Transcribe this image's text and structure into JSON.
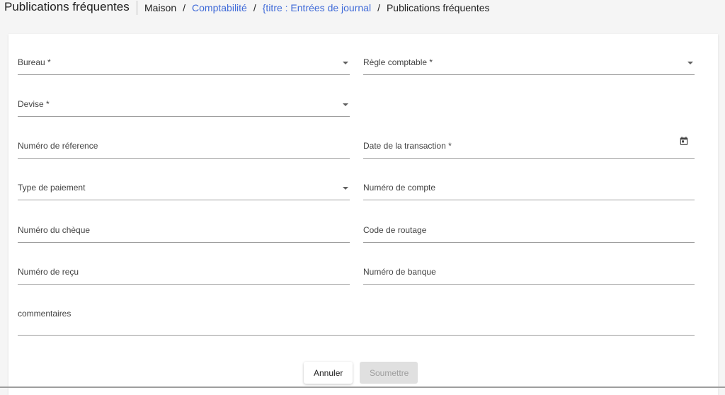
{
  "header": {
    "title": "Publications fréquentes",
    "breadcrumb": [
      "Maison",
      "Comptabilité",
      "{titre : Entrées de journal",
      "Publications fréquentes"
    ],
    "separator": "/"
  },
  "form": {
    "bureau": "Bureau *",
    "regle_comptable": "Règle comptable *",
    "devise": "Devise *",
    "numero_reference": "Numéro de réference",
    "date_transaction": "Date de la transaction *",
    "type_paiement": "Type de paiement",
    "numero_compte": "Numéro de compte",
    "numero_cheque": "Numéro du chèque",
    "code_routage": "Code de routage",
    "numero_recu": "Numéro de reçu",
    "numero_banque": "Numéro de banque",
    "commentaires": "commentaires"
  },
  "buttons": {
    "cancel": "Annuler",
    "submit": "Soumettre"
  },
  "icons": {
    "dropdown": "chevron-down-icon",
    "calendar": "calendar-icon"
  },
  "colors": {
    "link": "#3f6ad8",
    "disabled_button_bg": "#e0e0e0"
  }
}
